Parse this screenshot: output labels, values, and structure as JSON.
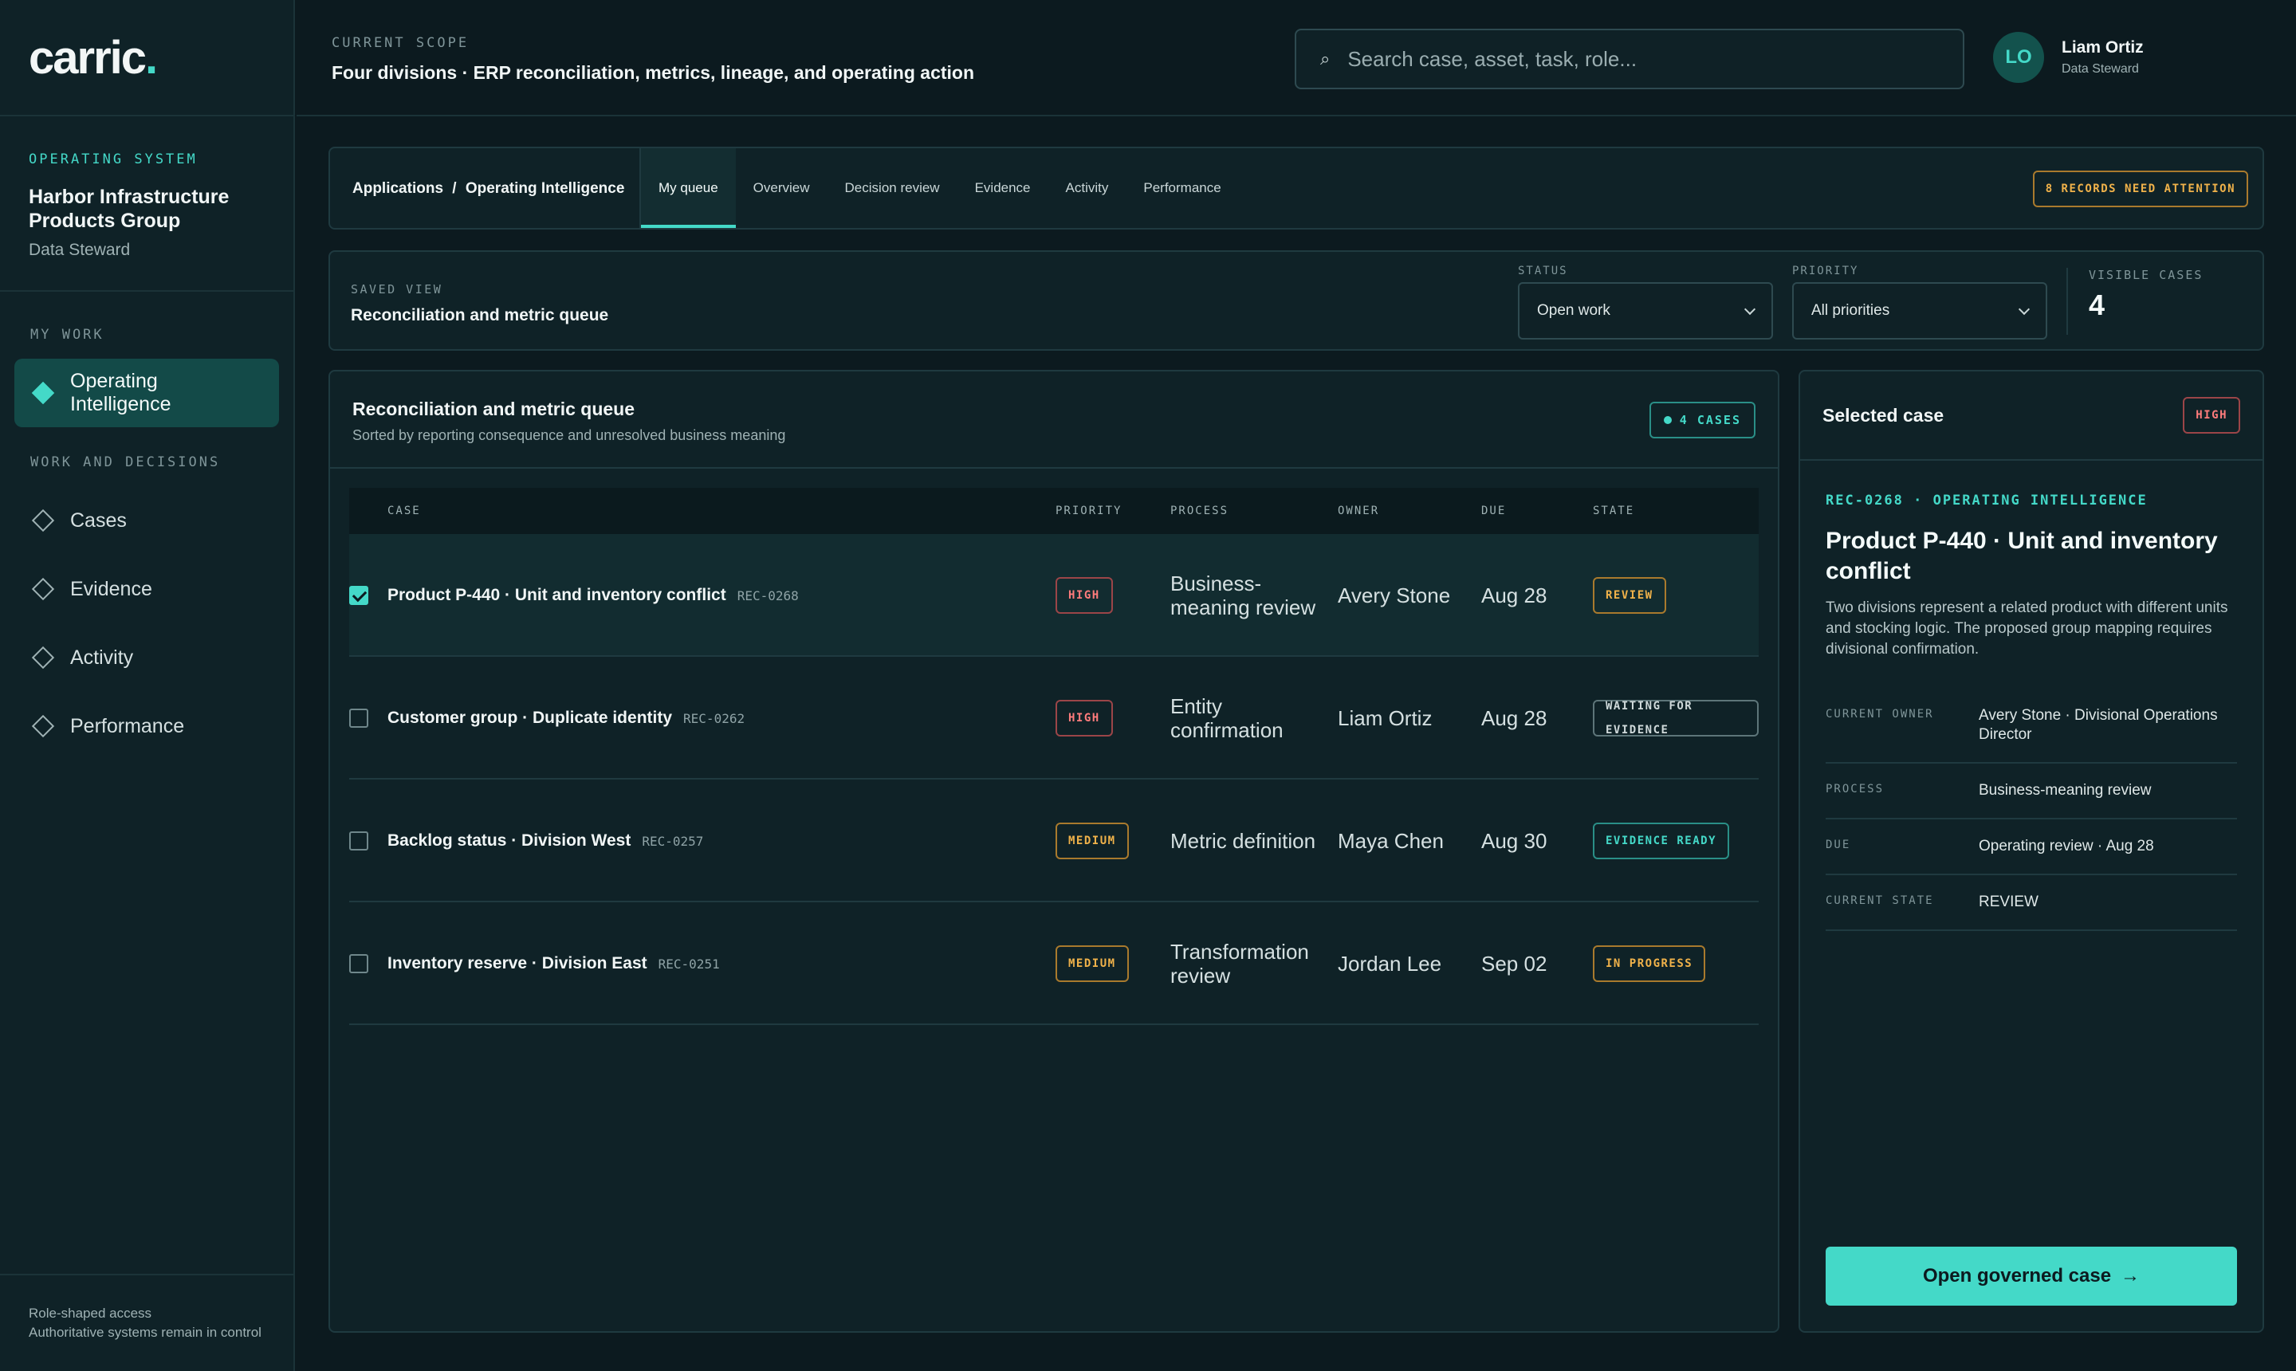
{
  "app": {
    "logo_text": "carric",
    "logo_dot": "."
  },
  "org": {
    "eyebrow": "OPERATING SYSTEM",
    "name": "Harbor Infrastructure Products Group",
    "role": "Data Steward"
  },
  "sidebar": {
    "my_work_label": "MY WORK",
    "active_item": "Operating Intelligence",
    "section_label": "WORK AND DECISIONS",
    "items": [
      {
        "label": "Cases"
      },
      {
        "label": "Evidence"
      },
      {
        "label": "Activity"
      },
      {
        "label": "Performance"
      }
    ],
    "footer_line1": "Role-shaped access",
    "footer_line2": "Authoritative systems remain in control"
  },
  "topbar": {
    "scope_label": "CURRENT SCOPE",
    "scope_text": "Four divisions · ERP reconciliation, metrics, lineage, and operating action",
    "search_placeholder": "Search case, asset, task, role...",
    "user_initials": "LO",
    "user_name": "Liam Ortiz",
    "user_role": "Data Steward"
  },
  "breadcrumb": {
    "root": "Applications",
    "sep": "/",
    "current": "Operating Intelligence"
  },
  "tabs": [
    {
      "label": "My queue",
      "active": true
    },
    {
      "label": "Overview"
    },
    {
      "label": "Decision review"
    },
    {
      "label": "Evidence"
    },
    {
      "label": "Activity"
    },
    {
      "label": "Performance"
    }
  ],
  "attention_badge": "8 RECORDS NEED ATTENTION",
  "view": {
    "saved_label": "SAVED VIEW",
    "saved_title": "Reconciliation and metric queue",
    "status_label": "STATUS",
    "status_value": "Open work",
    "priority_label": "PRIORITY",
    "priority_value": "All priorities",
    "visible_label": "VISIBLE CASES",
    "visible_count": "4"
  },
  "queue": {
    "title": "Reconciliation and metric queue",
    "subtitle": "Sorted by reporting consequence and unresolved business meaning",
    "count_badge": "4 CASES",
    "columns": {
      "case": "CASE",
      "priority": "PRIORITY",
      "process": "PROCESS",
      "owner": "OWNER",
      "due": "DUE",
      "state": "STATE"
    },
    "rows": [
      {
        "name": "Product P-440 · Unit and inventory conflict",
        "id": "REC-0268",
        "priority": "HIGH",
        "process": "Business-meaning review",
        "owner": "Avery Stone",
        "due": "Aug 28",
        "state": "REVIEW",
        "checked": true
      },
      {
        "name": "Customer group · Duplicate identity",
        "id": "REC-0262",
        "priority": "HIGH",
        "process": "Entity confirmation",
        "owner": "Liam Ortiz",
        "due": "Aug 28",
        "state": "WAITING FOR EVIDENCE",
        "checked": false
      },
      {
        "name": "Backlog status · Division West",
        "id": "REC-0257",
        "priority": "MEDIUM",
        "process": "Metric definition",
        "owner": "Maya Chen",
        "due": "Aug 30",
        "state": "EVIDENCE READY",
        "checked": false
      },
      {
        "name": "Inventory reserve · Division East",
        "id": "REC-0251",
        "priority": "MEDIUM",
        "process": "Transformation review",
        "owner": "Jordan Lee",
        "due": "Sep 02",
        "state": "IN PROGRESS",
        "checked": false
      }
    ]
  },
  "detail": {
    "title": "Selected case",
    "priority": "HIGH",
    "ref": "REC-0268 · OPERATING INTELLIGENCE",
    "case_title": "Product P-440 · Unit and inventory conflict",
    "description": "Two divisions represent a related product with different units and stocking logic. The proposed group mapping requires divisional confirmation.",
    "facts": [
      {
        "label": "CURRENT OWNER",
        "value": "Avery Stone · Divisional Operations Director"
      },
      {
        "label": "PROCESS",
        "value": "Business-meaning review"
      },
      {
        "label": "DUE",
        "value": "Operating review · Aug 28"
      },
      {
        "label": "CURRENT STATE",
        "value": "REVIEW"
      }
    ],
    "open_button": "Open governed case",
    "open_arrow": "→"
  },
  "colors": {
    "accent": "#44d9c8",
    "background": "#0c1a1f",
    "panel": "#0f2227",
    "high": "#ff7c7c",
    "medium": "#f0b24a"
  }
}
